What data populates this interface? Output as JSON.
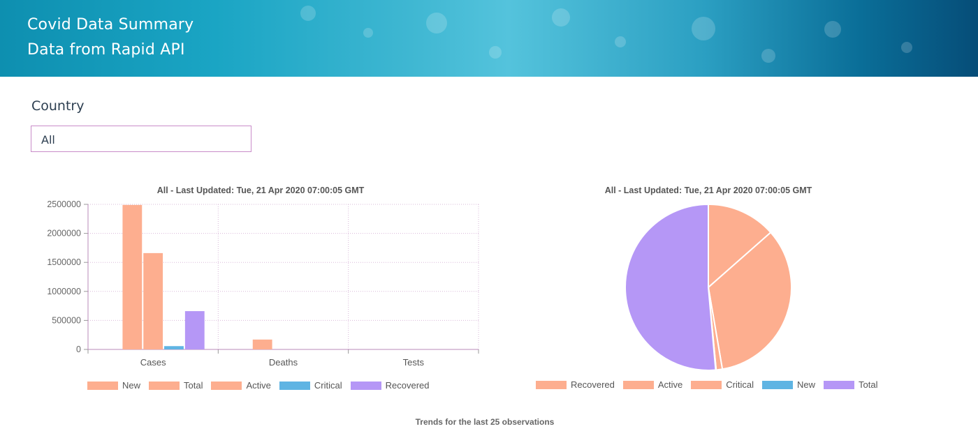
{
  "header": {
    "title": "Covid Data Summary",
    "subtitle": "Data from Rapid API"
  },
  "filter": {
    "label": "Country",
    "selected": "All"
  },
  "footer_text": "Trends for the last 25 observations",
  "chart_data": [
    {
      "type": "bar",
      "title": "All - Last Updated: Tue, 21 Apr 2020 07:00:05 GMT",
      "categories": [
        "Cases",
        "Deaths",
        "Tests"
      ],
      "ylim": [
        0,
        2500000
      ],
      "yticks": [
        "0",
        "500000",
        "1000000",
        "1500000",
        "2000000",
        "2500000"
      ],
      "grid": true,
      "legend_position": "bottom",
      "series": [
        {
          "name": "New",
          "color": "#fdae8f",
          "values": [
            0,
            0,
            0
          ]
        },
        {
          "name": "Total",
          "color": "#fdae8f",
          "values": [
            2490000,
            170000,
            0
          ]
        },
        {
          "name": "Active",
          "color": "#fdae8f",
          "values": [
            1660000,
            0,
            0
          ]
        },
        {
          "name": "Critical",
          "color": "#5fb4e3",
          "values": [
            57000,
            0,
            0
          ]
        },
        {
          "name": "Recovered",
          "color": "#b597f6",
          "values": [
            660000,
            0,
            0
          ]
        }
      ]
    },
    {
      "type": "pie",
      "title": "All - Last Updated: Tue, 21 Apr 2020 07:00:05 GMT",
      "legend_position": "bottom",
      "slices": [
        {
          "name": "Recovered",
          "color": "#fdae8f",
          "value": 13.5
        },
        {
          "name": "Active",
          "color": "#fdae8f",
          "value": 33.8
        },
        {
          "name": "Critical",
          "color": "#fdae8f",
          "value": 1.2
        },
        {
          "name": "New",
          "color": "#5fb4e3",
          "value": 0.1
        },
        {
          "name": "Total",
          "color": "#b597f6",
          "value": 51.4
        }
      ]
    }
  ]
}
